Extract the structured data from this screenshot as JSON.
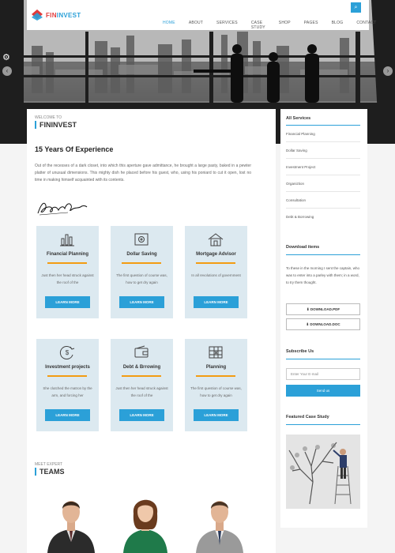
{
  "brand": {
    "name_part1": "FIN",
    "name_part2": "INVEST"
  },
  "nav": [
    "HOME",
    "ABOUT",
    "SERVICES",
    "CASE STUDY",
    "SHOP",
    "PAGES",
    "BLOG",
    "CONTACT"
  ],
  "main": {
    "welcome": "WELCOME TO",
    "company": "FININVEST",
    "experience_title": "15 Years Of Experience",
    "experience_text": "Out of the recesses of a dark closet, into which this aperture gave admittance, he brought a large pasty, baked in a pewter platter of unusual dimensions. This mighty dish he placed before his guest, who, using his poniard to cut it open, lost no time in making himself acquainted with its contents."
  },
  "services": [
    {
      "title": "Financial Planning",
      "desc": "Just then her head struck against the roof of the",
      "btn": "LEARN MORE",
      "icon": "chart-icon"
    },
    {
      "title": "Dollar Saving",
      "desc": "The first question of course was, how to get dry again",
      "btn": "LEARN MORE",
      "icon": "safe-icon"
    },
    {
      "title": "Mortgage Advisor",
      "desc": "In all revolutions of government",
      "btn": "LEARN MORE",
      "icon": "house-icon"
    },
    {
      "title": "Investment projects",
      "desc": "She clutched the matron by the arm, and forcing her",
      "btn": "LEARN MORE",
      "icon": "dollar-icon"
    },
    {
      "title": "Debt & Brrowing",
      "desc": "Just then her head struck against the roof of the",
      "btn": "LEARN MORE",
      "icon": "wallet-icon"
    },
    {
      "title": "Planning",
      "desc": "The first question of course was, how to get dry again",
      "btn": "LEARN MORE",
      "icon": "plan-icon"
    }
  ],
  "team": {
    "subtitle": "MEET EXPERT",
    "title": "TEAMS"
  },
  "sidebar": {
    "services_title": "All Services",
    "services": [
      "Financial Planning",
      "Dollar Saving",
      "Investment Project",
      "Organiztion",
      "Consultation",
      "Debt & Borrowing"
    ],
    "download_title": "Download items",
    "download_text": "To these in the morning I sent the captain, who was to enter into a parley with them; in a word, to try them thought.",
    "pdf": "DOWNLOAD.PDF",
    "doc": "DOWNLOAD.DOC",
    "subscribe_title": "Subscribe Us",
    "email_placeholder": "Enter Your E-mail",
    "send": "Send us",
    "case_title": "Featured Case Study"
  },
  "colors": {
    "accent": "#2ba0d8",
    "underline": "#f39c12",
    "brand_red": "#e23b3b"
  }
}
